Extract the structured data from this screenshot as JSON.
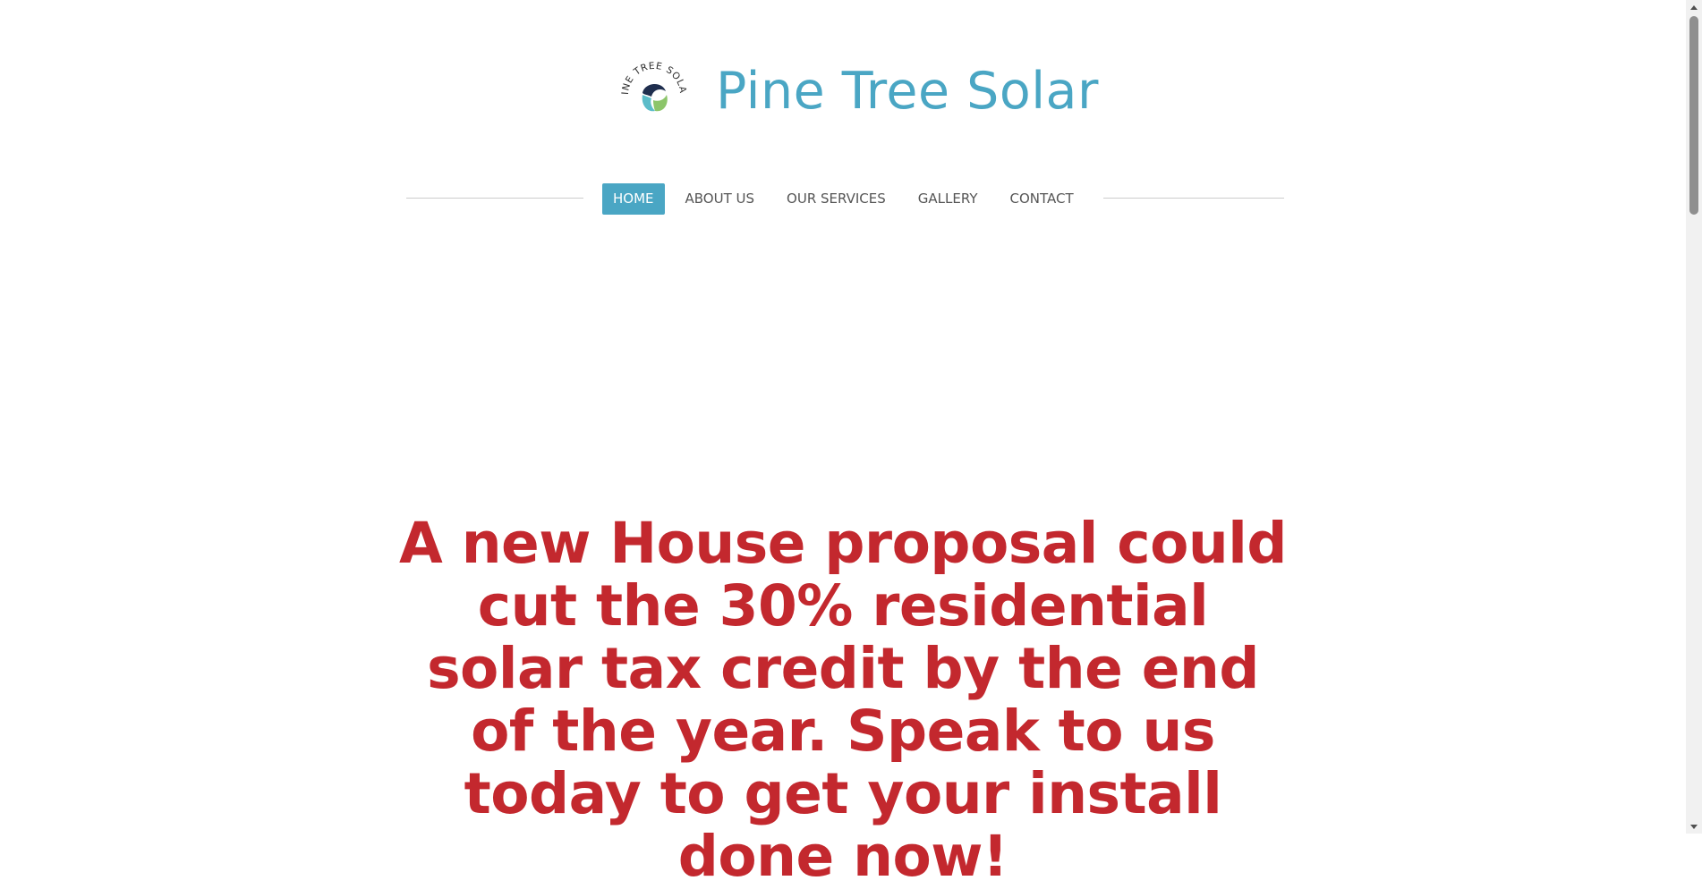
{
  "site": {
    "title": "Pine Tree Solar",
    "logo_text": "PINE TREE SOLAR",
    "logo_colors": {
      "navy": "#1f2e4e",
      "teal": "#5bbcc9",
      "green": "#8cc56a"
    },
    "accent_color": "#4aa6c4"
  },
  "nav": {
    "items": [
      {
        "label": "HOME",
        "active": true
      },
      {
        "label": "ABOUT US",
        "active": false
      },
      {
        "label": "OUR SERVICES",
        "active": false
      },
      {
        "label": "GALLERY",
        "active": false
      },
      {
        "label": "CONTACT",
        "active": false
      }
    ]
  },
  "headline": {
    "text": "A new House proposal could cut the 30% residential solar tax credit by the end of the year. Speak to us today to get your install done now!",
    "color": "#c3282e"
  }
}
